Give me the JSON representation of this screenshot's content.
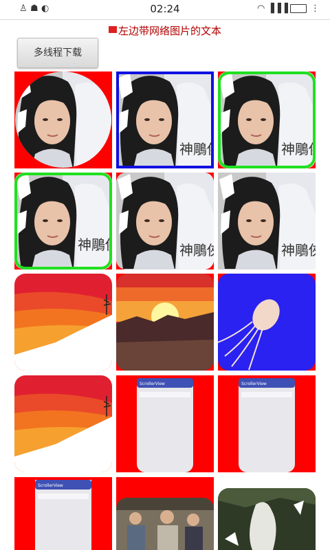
{
  "status_bar": {
    "time": "02:24"
  },
  "header": {
    "text": "左边带网络图片的文本"
  },
  "download_button": {
    "label": "多线程下载"
  },
  "images": {
    "portrait_text": "神鵰俠侶",
    "phone_title": "ScrollerView"
  }
}
